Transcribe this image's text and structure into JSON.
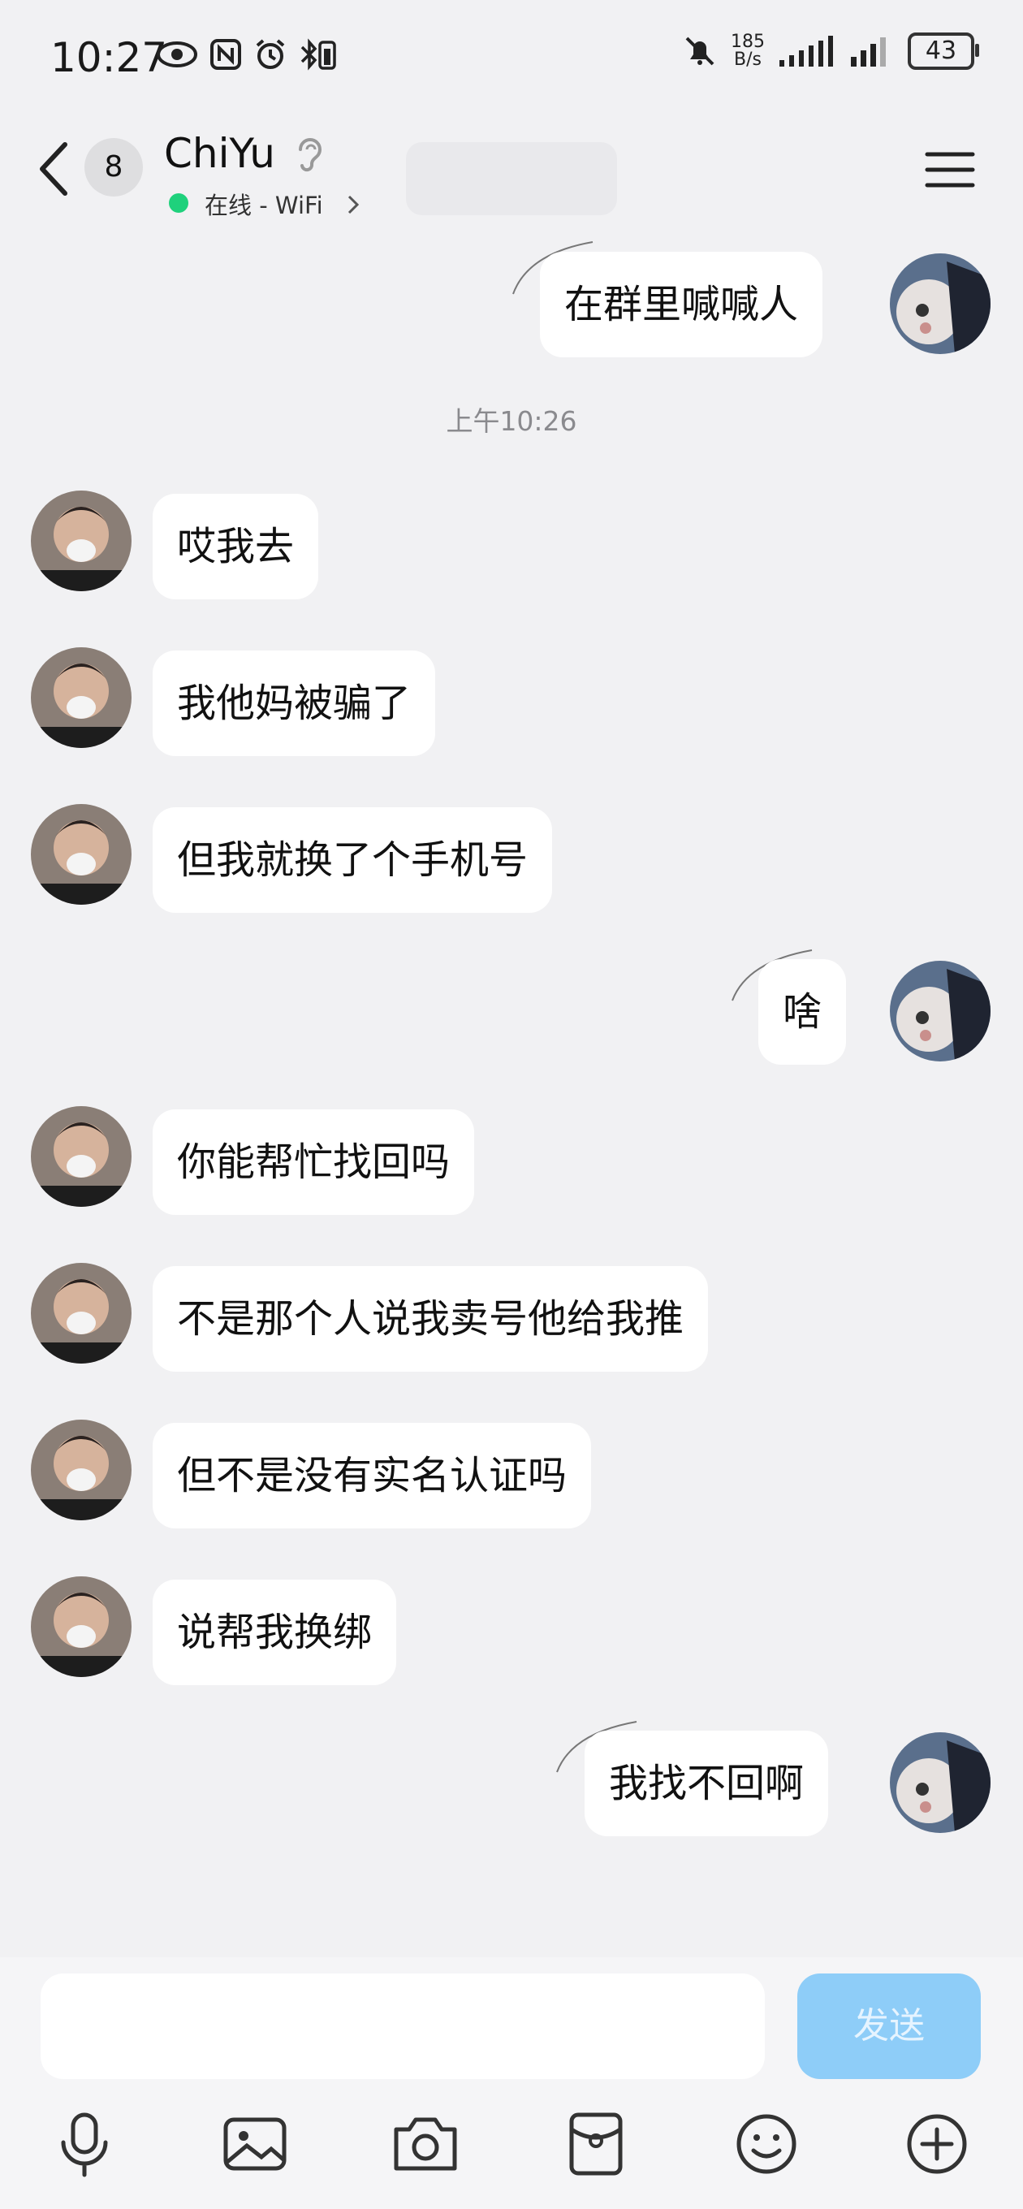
{
  "status_bar": {
    "time": "10:27",
    "net_speed_value": "185",
    "net_speed_unit": "B/s",
    "battery": "43"
  },
  "header": {
    "unread_badge": "8",
    "contact_name": "ChiYu",
    "online_status": "在线 - WiFi"
  },
  "chat": {
    "timestamp": "上午10:26",
    "messages": [
      {
        "from": "me",
        "text": "在群里喊喊人"
      },
      {
        "from": "them",
        "text": "哎我去"
      },
      {
        "from": "them",
        "text": "我他妈被骗了"
      },
      {
        "from": "them",
        "text": "但我就换了个手机号"
      },
      {
        "from": "me",
        "text": "啥"
      },
      {
        "from": "them",
        "text": "你能帮忙找回吗"
      },
      {
        "from": "them",
        "text": "不是那个人说我卖号他给我推"
      },
      {
        "from": "them",
        "text": "但不是没有实名认证吗"
      },
      {
        "from": "them",
        "text": "说帮我换绑"
      },
      {
        "from": "me",
        "text": "我找不回啊"
      }
    ]
  },
  "composer": {
    "send_label": "发送",
    "send_color": "#8ecdf8"
  },
  "toolbar_icons": [
    "microphone-icon",
    "image-icon",
    "camera-icon",
    "red-packet-icon",
    "emoji-icon",
    "plus-icon"
  ]
}
